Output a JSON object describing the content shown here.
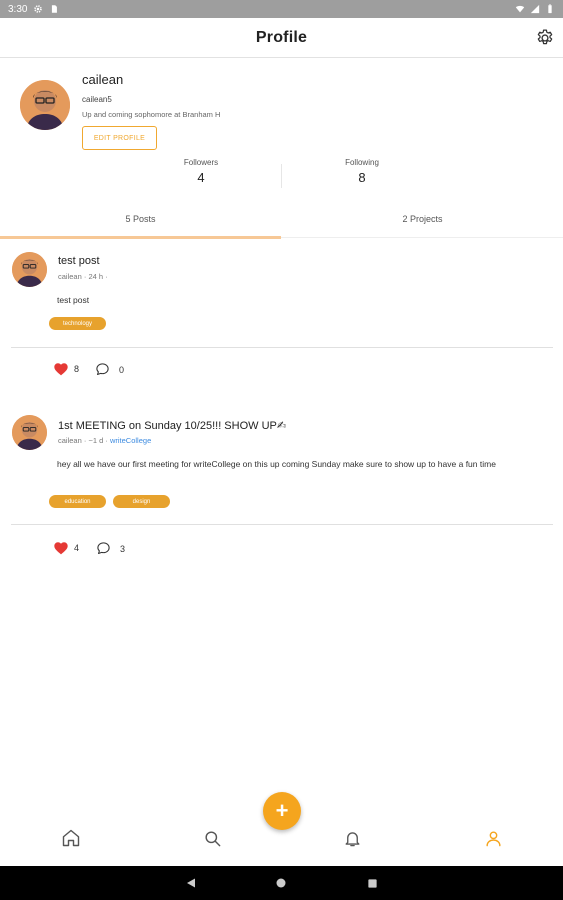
{
  "status_bar": {
    "time": "3:30",
    "left_icons": [
      "gear-icon",
      "sd-card-icon"
    ],
    "right_icons": [
      "wifi-icon",
      "signal-icon",
      "battery-icon"
    ]
  },
  "app_bar": {
    "title": "Profile",
    "settings_icon": "gear-icon"
  },
  "profile": {
    "name": "cailean",
    "username": "cailean5",
    "bio": "Up and coming sophomore at Branham H",
    "edit_button_label": "EDIT PROFILE",
    "followers_label": "Followers",
    "followers_count": "4",
    "following_label": "Following",
    "following_count": "8"
  },
  "tabs": [
    {
      "label": "5 Posts",
      "active": true
    },
    {
      "label": "2 Projects",
      "active": false
    }
  ],
  "posts": [
    {
      "title": "test post",
      "author": "cailean",
      "time": "24 h",
      "group": "",
      "body": "test post",
      "tags": [
        "technology"
      ],
      "likes": "8",
      "comments": "0"
    },
    {
      "title": "1st MEETING on Sunday 10/25!!! SHOW UP✍",
      "author": "cailean",
      "time": "~1 d",
      "group": "writeCollege",
      "body": "hey all we have our first meeting for writeCollege on this up coming Sunday make sure to show up to have a fun time",
      "tags": [
        "education",
        "design"
      ],
      "likes": "4",
      "comments": "3"
    }
  ],
  "fab": {
    "icon": "plus-icon",
    "label": "+"
  },
  "bottom_nav": [
    {
      "name": "home",
      "icon": "home-icon"
    },
    {
      "name": "search",
      "icon": "search-icon"
    },
    {
      "name": "notifications",
      "icon": "bell-icon"
    },
    {
      "name": "profile",
      "icon": "person-icon",
      "active": true
    }
  ],
  "colors": {
    "accent": "#f5a51e",
    "tag": "#e7a22d",
    "heart": "#e53935",
    "link": "#3d8be0",
    "tab_indicator": "#f7c896"
  }
}
